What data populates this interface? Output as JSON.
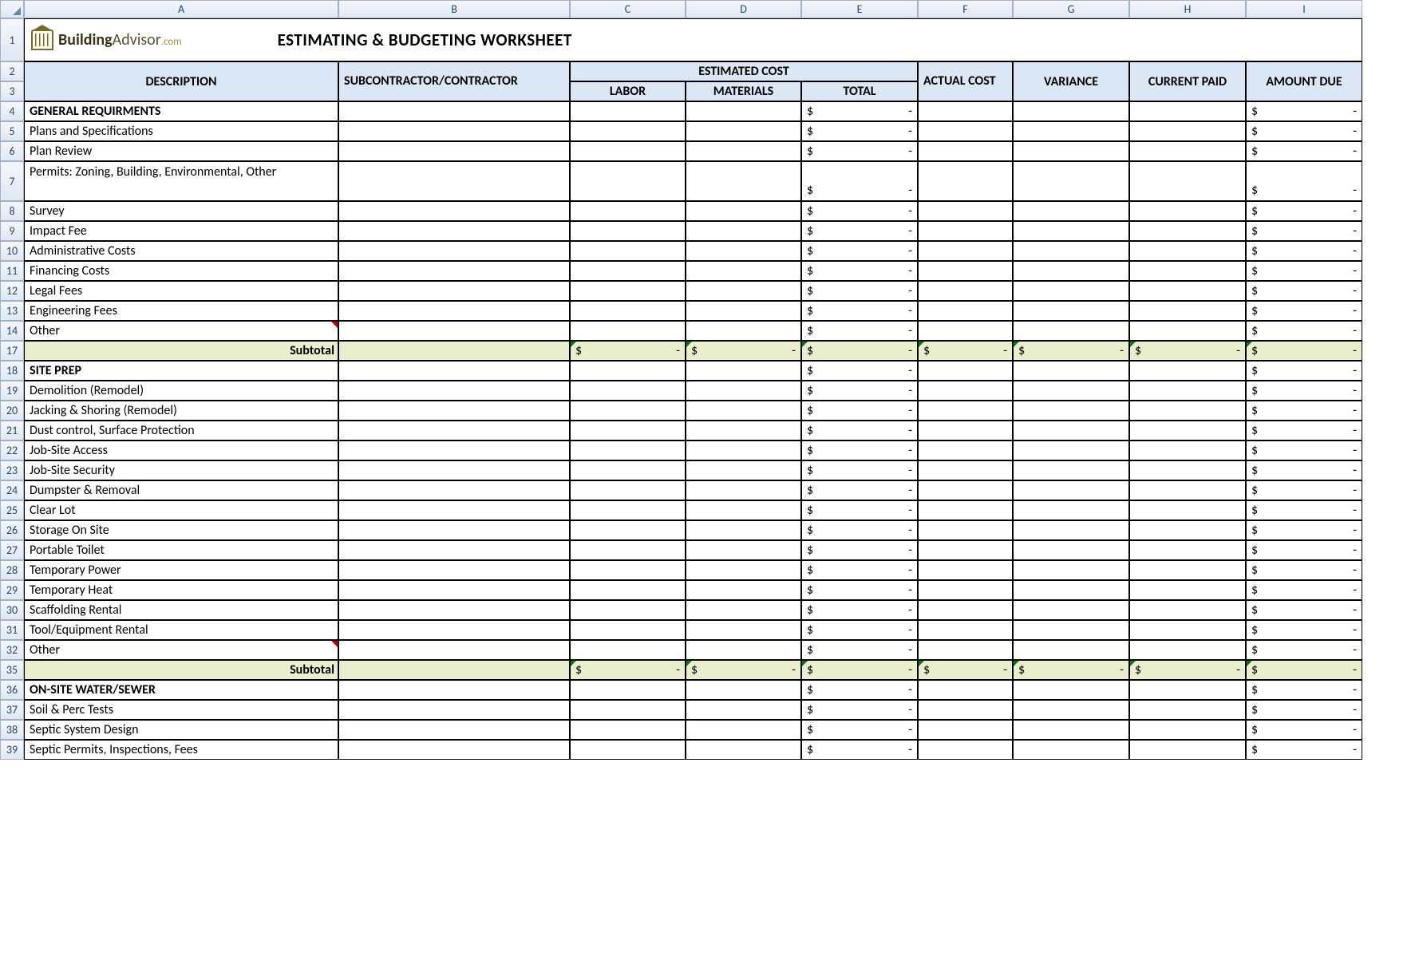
{
  "columns": [
    "A",
    "B",
    "C",
    "D",
    "E",
    "F",
    "G",
    "H",
    "I"
  ],
  "title": "ESTIMATING & BUDGETING WORKSHEET",
  "logo": {
    "brand_a": "Building",
    "brand_b": "Advisor",
    "tld": ".com"
  },
  "headers": {
    "description": "DESCRIPTION",
    "subcontractor": "SUBCONTRACTOR/CONTRACTOR",
    "estimated": "ESTIMATED COST",
    "labor": "LABOR",
    "materials": "MATERIALS",
    "total": "TOTAL",
    "actual": "ACTUAL COST",
    "variance": "VARIANCE",
    "current_paid": "CURRENT PAID",
    "amount_due": "AMOUNT DUE"
  },
  "money_placeholder": {
    "symbol": "$",
    "dash": "-"
  },
  "subtotal_label": "Subtotal",
  "rows": [
    {
      "n": 4,
      "label": "GENERAL REQUIRMENTS",
      "bold": true,
      "money": {
        "E": true,
        "I": true
      }
    },
    {
      "n": 5,
      "label": "Plans and Specifications",
      "money": {
        "E": true,
        "I": true
      }
    },
    {
      "n": 6,
      "label": "Plan Review",
      "money": {
        "E": true,
        "I": true
      }
    },
    {
      "n": 7,
      "label": "Permits: Zoning, Building, Environmental, Other",
      "wrap": true,
      "money": {
        "E": true,
        "I": true
      }
    },
    {
      "n": 8,
      "label": "Survey",
      "money": {
        "E": true,
        "I": true
      }
    },
    {
      "n": 9,
      "label": "Impact Fee",
      "money": {
        "E": true,
        "I": true
      }
    },
    {
      "n": 10,
      "label": "Administrative Costs",
      "money": {
        "E": true,
        "I": true
      }
    },
    {
      "n": 11,
      "label": "Financing Costs",
      "money": {
        "E": true,
        "I": true
      }
    },
    {
      "n": 12,
      "label": "Legal Fees",
      "money": {
        "E": true,
        "I": true
      }
    },
    {
      "n": 13,
      "label": "Engineering Fees",
      "money": {
        "E": true,
        "I": true
      }
    },
    {
      "n": 14,
      "label": "Other",
      "money": {
        "E": true,
        "I": true
      },
      "redtri": true
    },
    {
      "n": 17,
      "subtotal": true
    },
    {
      "n": 18,
      "label": "SITE PREP",
      "bold": true,
      "money": {
        "E": true,
        "I": true
      }
    },
    {
      "n": 19,
      "label": "Demolition (Remodel)",
      "money": {
        "E": true,
        "I": true
      }
    },
    {
      "n": 20,
      "label": "Jacking & Shoring (Remodel)",
      "money": {
        "E": true,
        "I": true
      }
    },
    {
      "n": 21,
      "label": "Dust control, Surface Protection",
      "money": {
        "E": true,
        "I": true
      }
    },
    {
      "n": 22,
      "label": "Job-Site Access",
      "money": {
        "E": true,
        "I": true
      }
    },
    {
      "n": 23,
      "label": "Job-Site Security",
      "money": {
        "E": true,
        "I": true
      }
    },
    {
      "n": 24,
      "label": "Dumpster & Removal",
      "money": {
        "E": true,
        "I": true
      }
    },
    {
      "n": 25,
      "label": "Clear Lot",
      "money": {
        "E": true,
        "I": true
      }
    },
    {
      "n": 26,
      "label": "Storage On Site",
      "money": {
        "E": true,
        "I": true
      }
    },
    {
      "n": 27,
      "label": "Portable Toilet",
      "money": {
        "E": true,
        "I": true
      }
    },
    {
      "n": 28,
      "label": "Temporary Power",
      "money": {
        "E": true,
        "I": true
      }
    },
    {
      "n": 29,
      "label": "Temporary Heat",
      "money": {
        "E": true,
        "I": true
      }
    },
    {
      "n": 30,
      "label": "Scaffolding Rental",
      "money": {
        "E": true,
        "I": true
      }
    },
    {
      "n": 31,
      "label": "Tool/Equipment Rental",
      "money": {
        "E": true,
        "I": true
      }
    },
    {
      "n": 32,
      "label": "Other",
      "money": {
        "E": true,
        "I": true
      },
      "redtri": true
    },
    {
      "n": 35,
      "subtotal": true
    },
    {
      "n": 36,
      "label": "ON-SITE WATER/SEWER",
      "bold": true,
      "money": {
        "E": true,
        "I": true
      }
    },
    {
      "n": 37,
      "label": "Soil & Perc Tests",
      "money": {
        "E": true,
        "I": true
      }
    },
    {
      "n": 38,
      "label": "Septic System Design",
      "money": {
        "E": true,
        "I": true
      }
    },
    {
      "n": 39,
      "label": "Septic Permits, Inspections, Fees",
      "money": {
        "E": true,
        "I": true
      },
      "cut": true
    }
  ]
}
